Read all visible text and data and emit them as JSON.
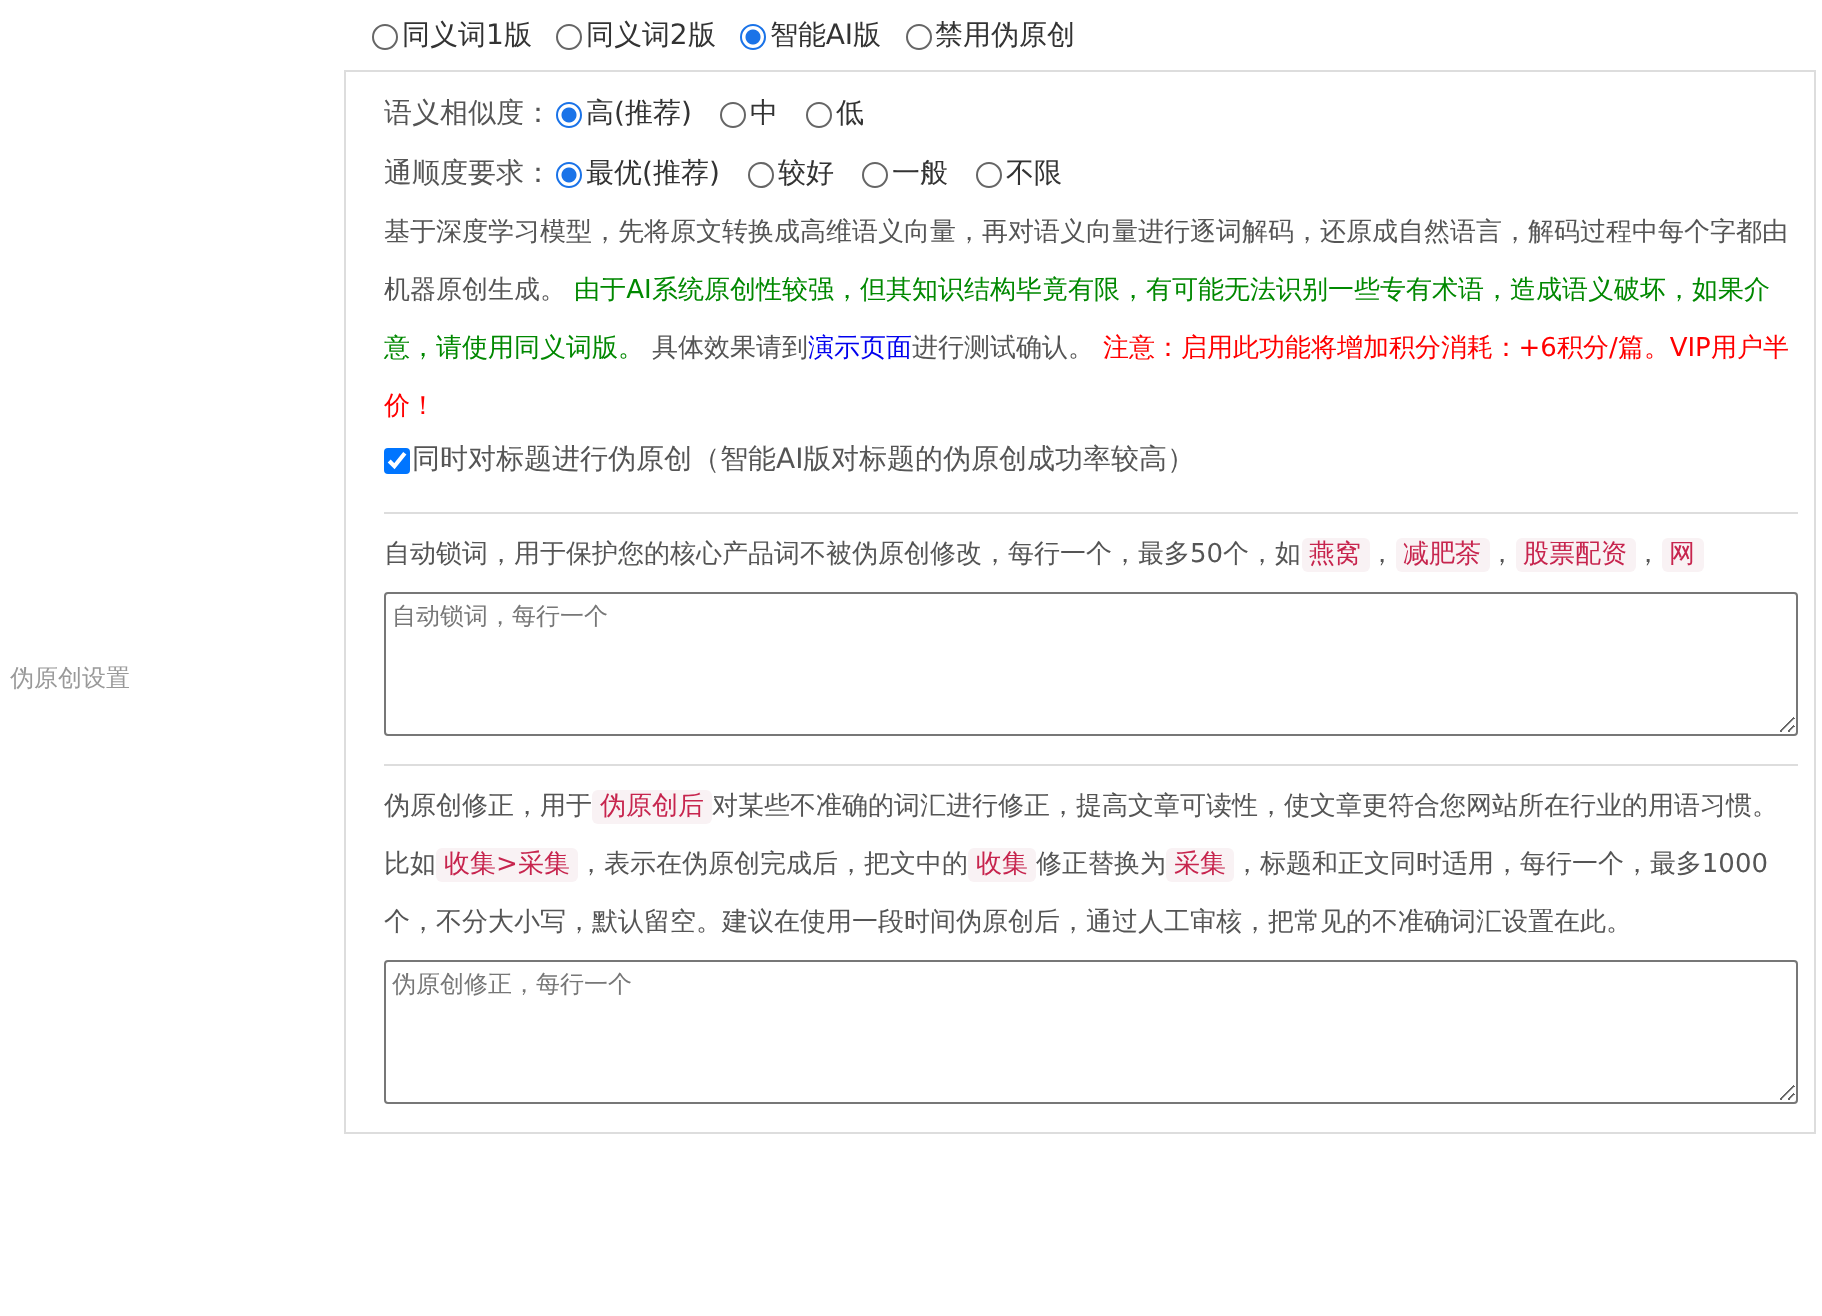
{
  "side_label": "伪原创设置",
  "modes": [
    {
      "label": "同义词1版",
      "selected": false
    },
    {
      "label": "同义词2版",
      "selected": false
    },
    {
      "label": "智能AI版",
      "selected": true
    },
    {
      "label": "禁用伪原创",
      "selected": false
    }
  ],
  "settings": [
    {
      "label": "语义相似度：",
      "options": [
        {
          "label": "高(推荐)",
          "selected": true
        },
        {
          "label": "中",
          "selected": false
        },
        {
          "label": "低",
          "selected": false
        }
      ]
    },
    {
      "label": "通顺度要求：",
      "options": [
        {
          "label": "最优(推荐)",
          "selected": true
        },
        {
          "label": "较好",
          "selected": false
        },
        {
          "label": "一般",
          "selected": false
        },
        {
          "label": "不限",
          "selected": false
        }
      ]
    }
  ],
  "description": [
    {
      "kind": "normal",
      "text": "基于深度学习模型，先将原文转换成高维语义向量，再对语义向量进行逐词解码，还原成自然语言，解码过程中每个字都由机器原创生成。 "
    },
    {
      "kind": "green",
      "text": "由于AI系统原创性较强，但其知识结构毕竟有限，有可能无法识别一些专有术语，造成语义破坏，如果介意，请使用同义词版。"
    },
    {
      "kind": "normal",
      "text": " 具体效果请到"
    },
    {
      "kind": "link",
      "text": "演示页面"
    },
    {
      "kind": "normal",
      "text": "进行测试确认。 "
    },
    {
      "kind": "red",
      "text": "注意：启用此功能将增加积分消耗：+6积分/篇。VIP用户半价！"
    }
  ],
  "title_option": {
    "label": "同时对标题进行伪原创（智能AI版对标题的伪原创成功率较高）",
    "checked": true
  },
  "lock": {
    "intro": [
      {
        "kind": "normal",
        "text": "自动锁词，用于保护您的核心产品词不被伪原创修改，每行一个，最多50个，如"
      },
      {
        "kind": "code",
        "text": "燕窝"
      },
      {
        "kind": "normal",
        "text": "，"
      },
      {
        "kind": "code",
        "text": "减肥茶"
      },
      {
        "kind": "normal",
        "text": "，"
      },
      {
        "kind": "code",
        "text": "股票配资"
      },
      {
        "kind": "normal",
        "text": "，"
      },
      {
        "kind": "code",
        "text": "网"
      }
    ],
    "placeholder": "自动锁词，每行一个"
  },
  "correction": {
    "intro": [
      {
        "kind": "normal",
        "text": "伪原创修正，用于"
      },
      {
        "kind": "code",
        "text": "伪原创后"
      },
      {
        "kind": "normal",
        "text": "对某些不准确的词汇进行修正，提高文章可读性，使文章更符合您网站所在行业的用语习惯。比如"
      },
      {
        "kind": "code",
        "text": "收集>采集"
      },
      {
        "kind": "normal",
        "text": "，表示在伪原创完成后，把文中的"
      },
      {
        "kind": "code",
        "text": "收集"
      },
      {
        "kind": "normal",
        "text": "修正替换为"
      },
      {
        "kind": "code",
        "text": "采集"
      },
      {
        "kind": "normal",
        "text": "，标题和正文同时适用，每行一个，最多1000个，不分大小写，默认留空。建议在使用一段时间伪原创后，通过人工审核，把常见的不准确词汇设置在此。"
      }
    ],
    "placeholder": "伪原创修正，每行一个"
  }
}
